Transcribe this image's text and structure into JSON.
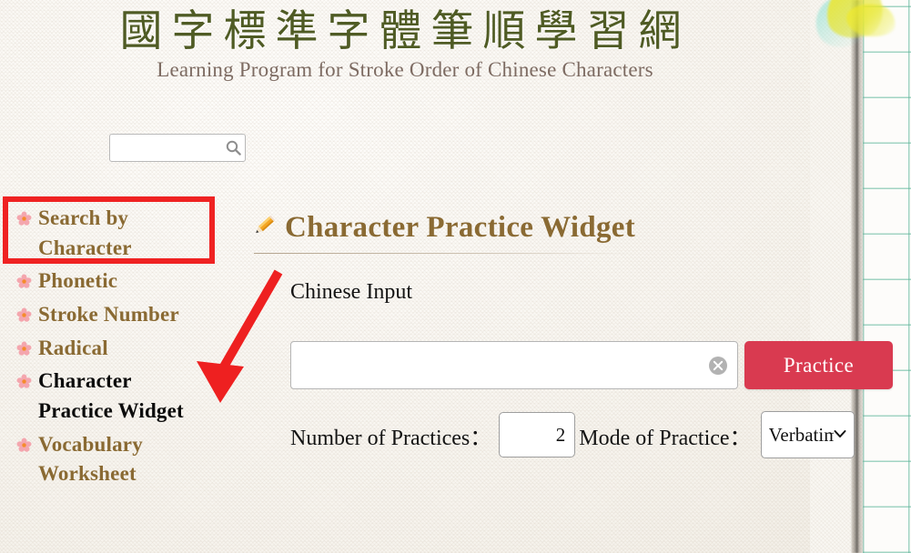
{
  "header": {
    "title_cn": "國字標準字體筆順學習網",
    "title_en": "Learning Program for Stroke Order of Chinese Characters",
    "title_color": "#4f5b24",
    "subtitle_color": "#7d6b62"
  },
  "search": {
    "value": "",
    "placeholder": "",
    "icon": "search-icon"
  },
  "sidebar": {
    "items": [
      {
        "label": "Search by Character",
        "active": false,
        "bullet": "flower-bullet-icon"
      },
      {
        "label": "Phonetic",
        "active": false,
        "bullet": "flower-bullet-icon"
      },
      {
        "label": "Stroke Number",
        "active": false,
        "bullet": "flower-bullet-icon"
      },
      {
        "label": "Radical",
        "active": false,
        "bullet": "flower-bullet-icon"
      },
      {
        "label": "Character Practice Widget",
        "active": true,
        "bullet": "flower-bullet-icon"
      },
      {
        "label": "Vocabulary Worksheet",
        "active": false,
        "bullet": "flower-bullet-icon"
      }
    ],
    "active_index": 4,
    "highlight_color": "#ef2222",
    "link_color": "#8a6a33",
    "active_link_color": "#0c0c0c"
  },
  "main": {
    "heading": "Character Practice Widget",
    "heading_icon": "pencil-icon",
    "heading_color": "#8a6a33",
    "input_section_label": "Chinese Input",
    "chinese_input": {
      "value": "",
      "placeholder": "",
      "clear_icon": "clear-circle-x-icon"
    },
    "practice_button": {
      "label": "Practice",
      "color": "#d93a50",
      "text_color": "#ffffff"
    },
    "number_of_practices": {
      "label": "Number of Practices：",
      "value": "2"
    },
    "mode_of_practice": {
      "label": "Mode of Practice：",
      "selected": "Verbatim",
      "options": [
        "Verbatim"
      ],
      "caret_icon": "chevron-down-icon"
    }
  },
  "annotation": {
    "arrow_color": "#ee2020",
    "box_color": "#ef2222",
    "points_to": "Character Practice Widget"
  }
}
